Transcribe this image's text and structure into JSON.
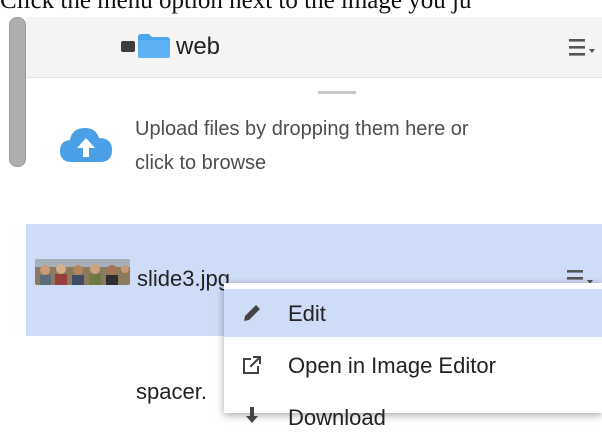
{
  "instruction": "Click the menu option next to the image you ju",
  "folder": {
    "name": "web"
  },
  "upload": {
    "line1": "Upload files by dropping them here or",
    "line2": "click to browse"
  },
  "selected_file": {
    "name": "slide3.jpg"
  },
  "next_file": {
    "name": "spacer."
  },
  "context_menu": {
    "items": [
      {
        "label": "Edit",
        "icon": "pencil-icon"
      },
      {
        "label": "Open in Image Editor",
        "icon": "external-link-icon"
      },
      {
        "label": "Download",
        "icon": "download-icon"
      }
    ]
  },
  "colors": {
    "selected_row": "#cfdcf7",
    "folder_icon": "#4ea6ee",
    "cloud_icon": "#4a9fe6"
  }
}
